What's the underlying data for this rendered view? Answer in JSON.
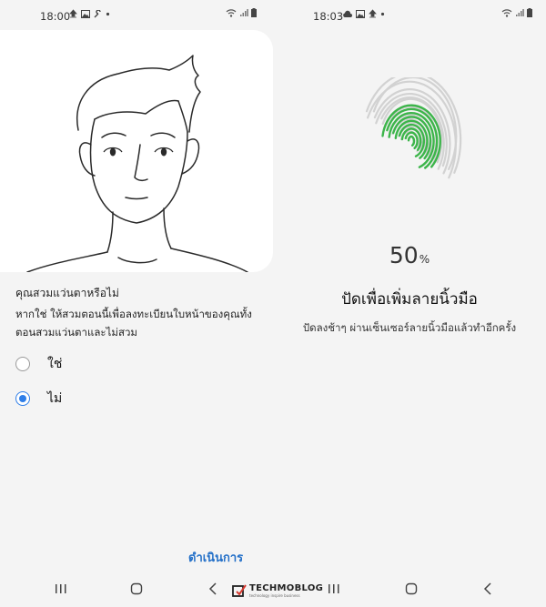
{
  "left_screen": {
    "status_bar": {
      "time": "18:00"
    },
    "question": "คุณสวมแว่นตาหรือไม่",
    "hint": "หากใช่ ให้สวมตอนนี้เพื่อลงทะเบียนใบหน้าของคุณทั้งตอนสวมแว่นตาและไม่สวม",
    "options": [
      {
        "label": "ใช่",
        "selected": false
      },
      {
        "label": "ไม่",
        "selected": true
      }
    ],
    "continue_label": "ดำเนินการ"
  },
  "right_screen": {
    "status_bar": {
      "time": "18:03"
    },
    "progress_value": "50",
    "progress_unit": "%",
    "title": "ปัดเพื่อเพิ่มลายนิ้วมือ",
    "description": "ปัดลงช้าๆ ผ่านเซ็นเซอร์ลายนิ้วมือแล้วทำอีกครั้ง"
  },
  "watermark": {
    "name": "TECHMOBLOG",
    "tagline": "technology inspire business"
  },
  "colors": {
    "accent": "#2e7ee8",
    "link": "#2470c8",
    "fingerprint_progress": "#3cb54a",
    "fingerprint_base": "#d0d0d0"
  },
  "icons": [
    "upload-icon",
    "image-icon",
    "wrench-icon",
    "dot-icon",
    "cloud-icon",
    "wifi-icon",
    "signal-icon",
    "battery-icon",
    "recent-apps-icon",
    "home-icon",
    "back-icon",
    "watermark-logo-icon"
  ]
}
